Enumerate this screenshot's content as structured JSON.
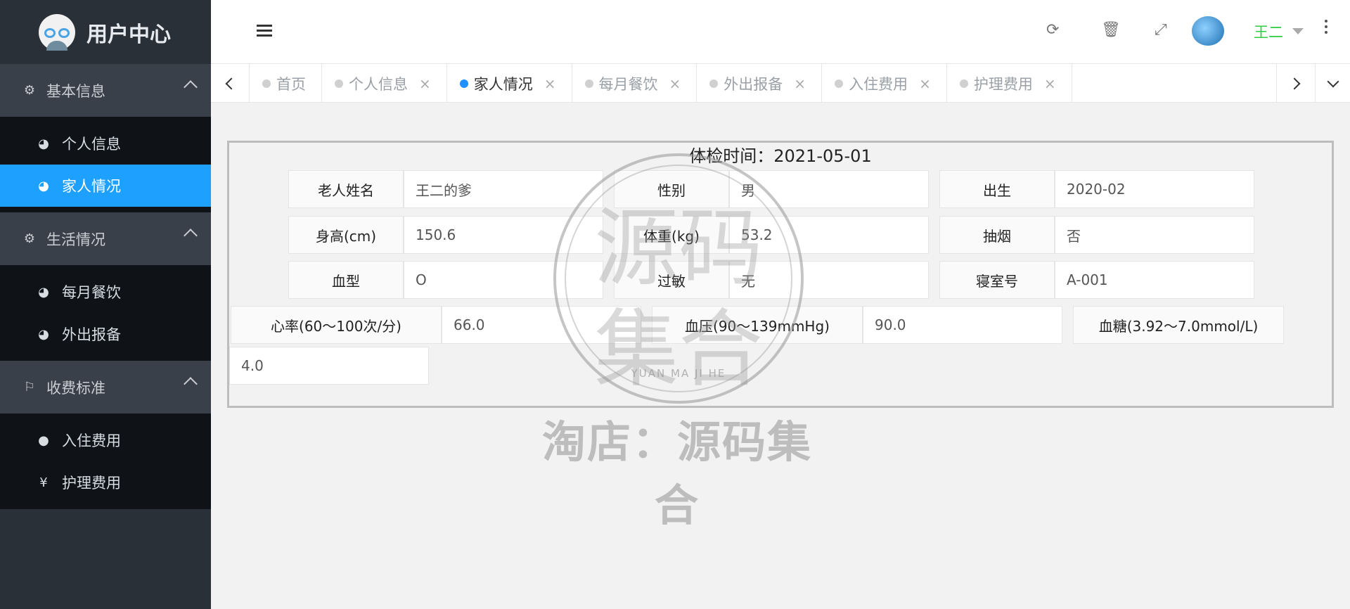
{
  "sidebar": {
    "app_title": "用户中心",
    "groups": [
      {
        "label": "基本信息",
        "items": [
          {
            "label": "个人信息"
          },
          {
            "label": "家人情况"
          }
        ]
      },
      {
        "label": "生活情况",
        "items": [
          {
            "label": "每月餐饮"
          },
          {
            "label": "外出报备"
          }
        ]
      },
      {
        "label": "收费标准",
        "items": [
          {
            "label": "入住费用"
          },
          {
            "label": "护理费用"
          }
        ]
      }
    ]
  },
  "header": {
    "user_name": "王二"
  },
  "tabs": [
    {
      "label": "首页"
    },
    {
      "label": "个人信息"
    },
    {
      "label": "家人情况"
    },
    {
      "label": "每月餐饮"
    },
    {
      "label": "外出报备"
    },
    {
      "label": "入住费用"
    },
    {
      "label": "护理费用"
    }
  ],
  "form": {
    "title": "体检时间：2021-05-01",
    "name_label": "老人姓名",
    "name_value": "王二的爹",
    "gender_label": "性别",
    "gender_value": "男",
    "birth_label": "出生",
    "birth_value": "2020-02",
    "height_label": "身高(cm)",
    "height_value": "150.6",
    "weight_label": "体重(kg)",
    "weight_value": "53.2",
    "smoke_label": "抽烟",
    "smoke_value": "否",
    "blood_label": "血型",
    "blood_value": "O",
    "allergy_label": "过敏",
    "allergy_value": "无",
    "room_label": "寝室号",
    "room_value": "A-001",
    "heart_label": "心率(60～100次/分)",
    "heart_value": "66.0",
    "pressure_label": "血压(90～139mmHg)",
    "pressure_value": "90.0",
    "sugar_label": "血糖(3.92～7.0mmol/L)",
    "sugar_value": "4.0"
  },
  "watermark": {
    "chars": "源码集合",
    "latin": "YUAN MA JI HE",
    "shop": "淘店：源码集合"
  }
}
